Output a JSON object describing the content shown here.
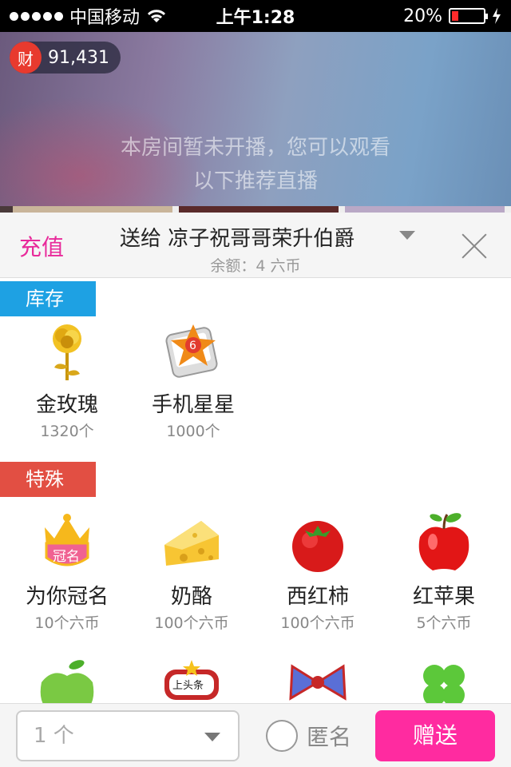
{
  "status_bar": {
    "carrier": "中国移动",
    "time": "上午1:28",
    "battery_percent": "20%",
    "battery_level": 0.2
  },
  "hero": {
    "coin_badge": "财",
    "coin_count": "91,431",
    "message_line1": "本房间暂未开播，您可以观看",
    "message_line2": "以下推荐直播"
  },
  "header": {
    "recharge_label": "充值",
    "send_to": "送给 凉子祝哥哥荣升伯爵",
    "balance": "余额：4 六币"
  },
  "sections": {
    "inventory_label": "库存",
    "special_label": "特殊"
  },
  "inventory_gifts": [
    {
      "name": "金玫瑰",
      "price": "1320个",
      "icon": "gold-rose-icon"
    },
    {
      "name": "手机星星",
      "price": "1000个",
      "icon": "phone-star-icon"
    }
  ],
  "special_gifts": [
    {
      "name": "为你冠名",
      "price": "10个六币",
      "icon": "crown-name-icon"
    },
    {
      "name": "奶酪",
      "price": "100个六币",
      "icon": "cheese-icon"
    },
    {
      "name": "西红柿",
      "price": "100个六币",
      "icon": "tomato-icon"
    },
    {
      "name": "红苹果",
      "price": "5个六币",
      "icon": "red-apple-icon"
    }
  ],
  "partial_gifts": [
    {
      "icon": "green-apple-icon"
    },
    {
      "icon": "headline-sign-icon",
      "text": "上头条"
    },
    {
      "icon": "bow-icon"
    },
    {
      "icon": "clover-icon"
    }
  ],
  "footer": {
    "quantity_value": "1 个",
    "anonymous_label": "匿名",
    "give_label": "赠送"
  },
  "colors": {
    "accent_pink": "#ff2ba0",
    "recharge_pink": "#e8299a",
    "tag_blue": "#1ea1e3",
    "tag_red": "#e24f43"
  }
}
